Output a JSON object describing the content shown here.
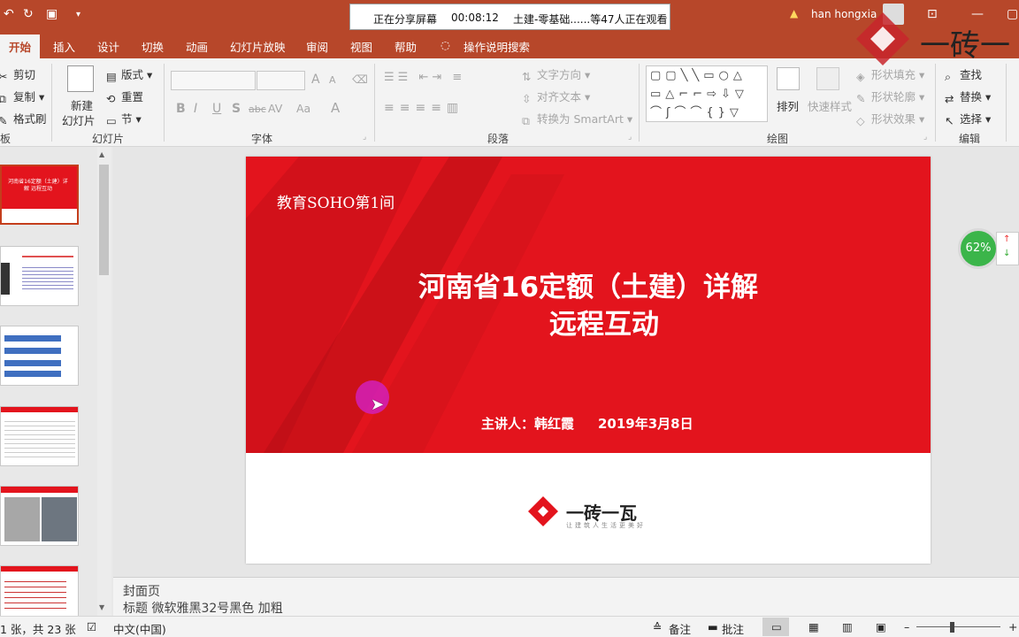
{
  "window": {
    "share_status": "正在分享屏幕",
    "share_timer": "00:08:12",
    "share_title": "土建-零基础......等47人正在观看",
    "user_name": "han hongxia"
  },
  "tabs": [
    "开始",
    "插入",
    "设计",
    "切换",
    "动画",
    "幻灯片放映",
    "审阅",
    "视图",
    "帮助",
    "操作说明搜索"
  ],
  "ribbon": {
    "clipboard": {
      "cut": "剪切",
      "copy": "复制",
      "format_painter": "格式刷",
      "group": "板"
    },
    "slides": {
      "new_slide_1": "新建",
      "new_slide_2": "幻灯片",
      "layout": "版式",
      "reset": "重置",
      "section": "节",
      "group": "幻灯片"
    },
    "font": {
      "bold": "B",
      "italic": "I",
      "underline": "U",
      "shadow": "S",
      "strike": "abc",
      "spacing": "AV",
      "case": "Aa",
      "grow": "A",
      "shrink": "A",
      "color": "A",
      "group": "字体"
    },
    "paragraph": {
      "text_direction": "文字方向",
      "align_text": "对齐文本",
      "smartart": "转换为 SmartArt",
      "group": "段落"
    },
    "drawing": {
      "arrange": "排列",
      "quick_styles": "快速样式",
      "shape_fill": "形状填充",
      "shape_outline": "形状轮廓",
      "shape_effects": "形状效果",
      "group": "绘图"
    },
    "editing": {
      "find": "查找",
      "replace": "替换",
      "select": "选择",
      "group": "编辑"
    }
  },
  "slide": {
    "subtitle_top": "教育SOHO第1间",
    "title_line1": "河南省16定额（土建）详解",
    "title_line2": "远程互动",
    "presenter": "主讲人：韩红霞",
    "date": "2019年3月8日",
    "logo_text": "一砖一瓦",
    "logo_tagline": "让建筑人生活更美好",
    "brand_color": "#e3141d"
  },
  "watermark": {
    "text": "一砖一"
  },
  "zoom_badge": "62%",
  "notes": {
    "line1": "封面页",
    "line2": "标题 微软雅黑32号黑色 加粗"
  },
  "thumbnails": [
    {
      "title": "河南省16定额（土建）详解 远程互动"
    },
    {
      "title": ""
    },
    {
      "title": ""
    },
    {
      "title": ""
    },
    {
      "title": ""
    },
    {
      "title": ""
    }
  ],
  "status": {
    "slide_count": "1 张，共 23 张",
    "language": "中文(中国)",
    "notes_btn": "备注",
    "comments_btn": "批注"
  }
}
